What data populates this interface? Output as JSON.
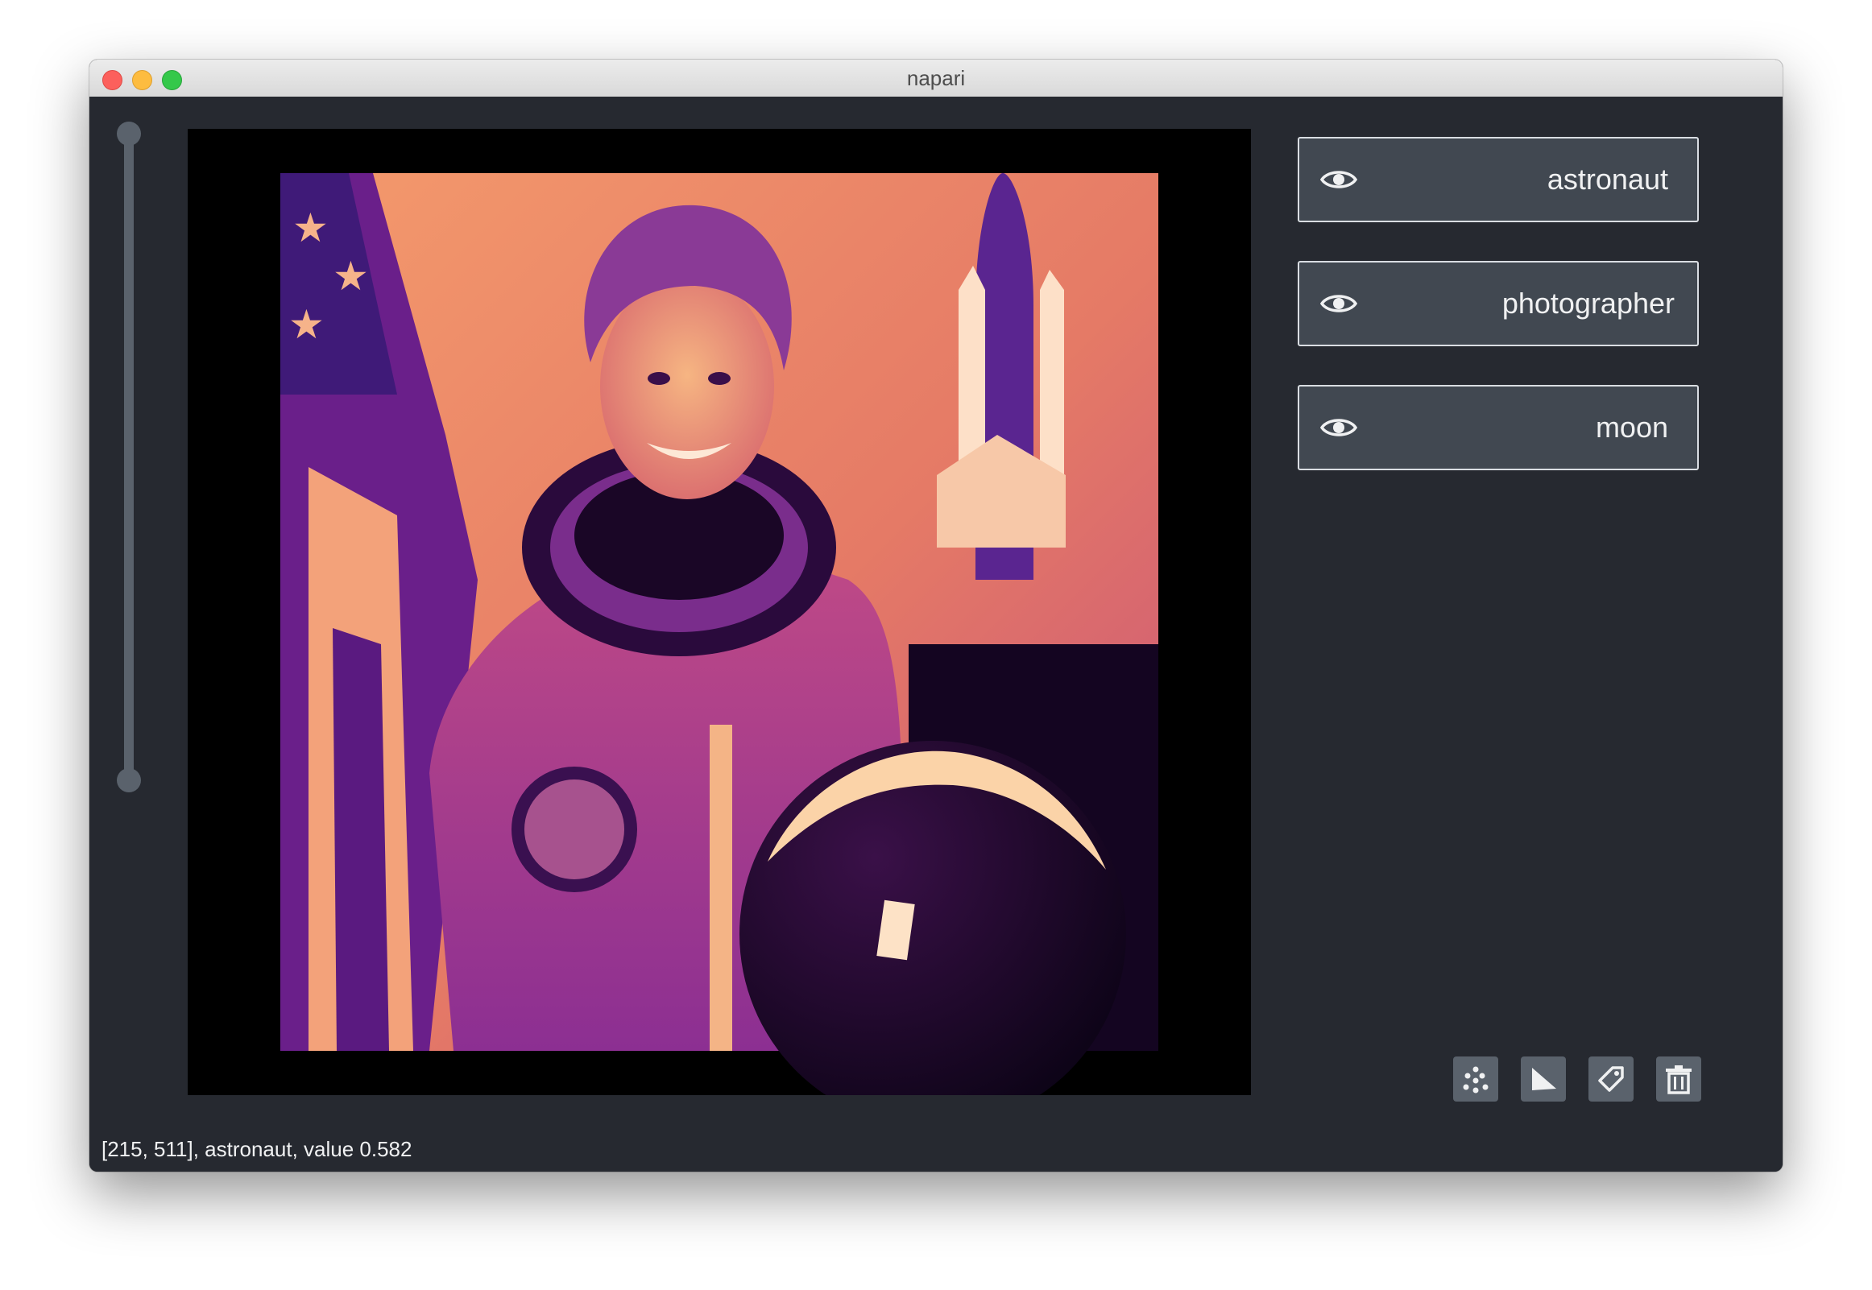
{
  "window": {
    "title": "napari"
  },
  "layers": [
    {
      "name": "astronaut",
      "icon": "eye-icon"
    },
    {
      "name": "photographer",
      "icon": "eye-icon"
    },
    {
      "name": "moon",
      "icon": "eye-icon"
    }
  ],
  "toolbar": {
    "buttons": [
      {
        "name": "new-points-button",
        "icon": "points-icon"
      },
      {
        "name": "new-shapes-button",
        "icon": "shapes-icon"
      },
      {
        "name": "new-labels-button",
        "icon": "tag-icon"
      },
      {
        "name": "delete-layer-button",
        "icon": "trash-icon"
      }
    ]
  },
  "viewer": {
    "image": "astronaut portrait",
    "colormap": "magma"
  },
  "status": {
    "text": "[215, 511], astronaut, value 0.582"
  },
  "colors": {
    "background": "#262930",
    "panel": "#414851",
    "button": "#5a626c",
    "text": "#f0f1f2"
  }
}
